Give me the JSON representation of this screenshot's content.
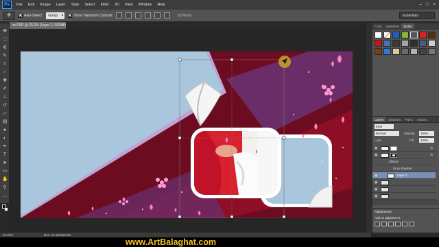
{
  "app": {
    "logo": "Ps"
  },
  "menu": [
    "File",
    "Edit",
    "Image",
    "Layer",
    "Type",
    "Select",
    "Filter",
    "3D",
    "View",
    "Window",
    "Help"
  ],
  "options": {
    "auto_select_label": "Auto-Select:",
    "auto_select_value": "Group",
    "transform_label": "Show Transform Controls",
    "mode_label": "3D Mode:",
    "workspace": "Essentials"
  },
  "document_tab": {
    "title": "sc.PSD @ 25.2% (Layer 2, RGB/8) *"
  },
  "status": {
    "zoom": "25.29%",
    "doc": "Doc: 23.1M/159.3M"
  },
  "panels": {
    "top_tabs": [
      "Color",
      "Swatches",
      "Styles"
    ],
    "layer_tabs": [
      "Layers",
      "Channels",
      "Paths",
      "Actions"
    ],
    "kind_label": "Kind",
    "blend_mode": "Normal",
    "opacity_label": "Opacity:",
    "opacity": "100%",
    "lock_label": "Lock:",
    "fill_label": "Fill:",
    "fill": "100%",
    "effects_label": "Effects",
    "drop_shadow_label": "Drop Shadow",
    "selected_layer": "Layer 1",
    "fx": "fx",
    "adjustments_title": "Adjustments",
    "adjustments_hint": "Add an adjustment"
  },
  "watermark": "www.ArtBalaghat.com",
  "colors": {
    "background_blue": "#a9c6dc",
    "maroon": "#5a0818",
    "crimson": "#8c0f26",
    "purple": "#6b2d68",
    "pink_petal": "#ff7fc0",
    "watermark_gold": "#f2c022"
  },
  "icons": [
    "move-tool-icon",
    "marquee-tool-icon",
    "lasso-tool-icon",
    "crop-tool-icon",
    "eyedropper-tool-icon",
    "brush-tool-icon",
    "eraser-tool-icon",
    "pen-tool-icon",
    "type-tool-icon",
    "hand-tool-icon",
    "zoom-tool-icon",
    "eye-icon"
  ]
}
